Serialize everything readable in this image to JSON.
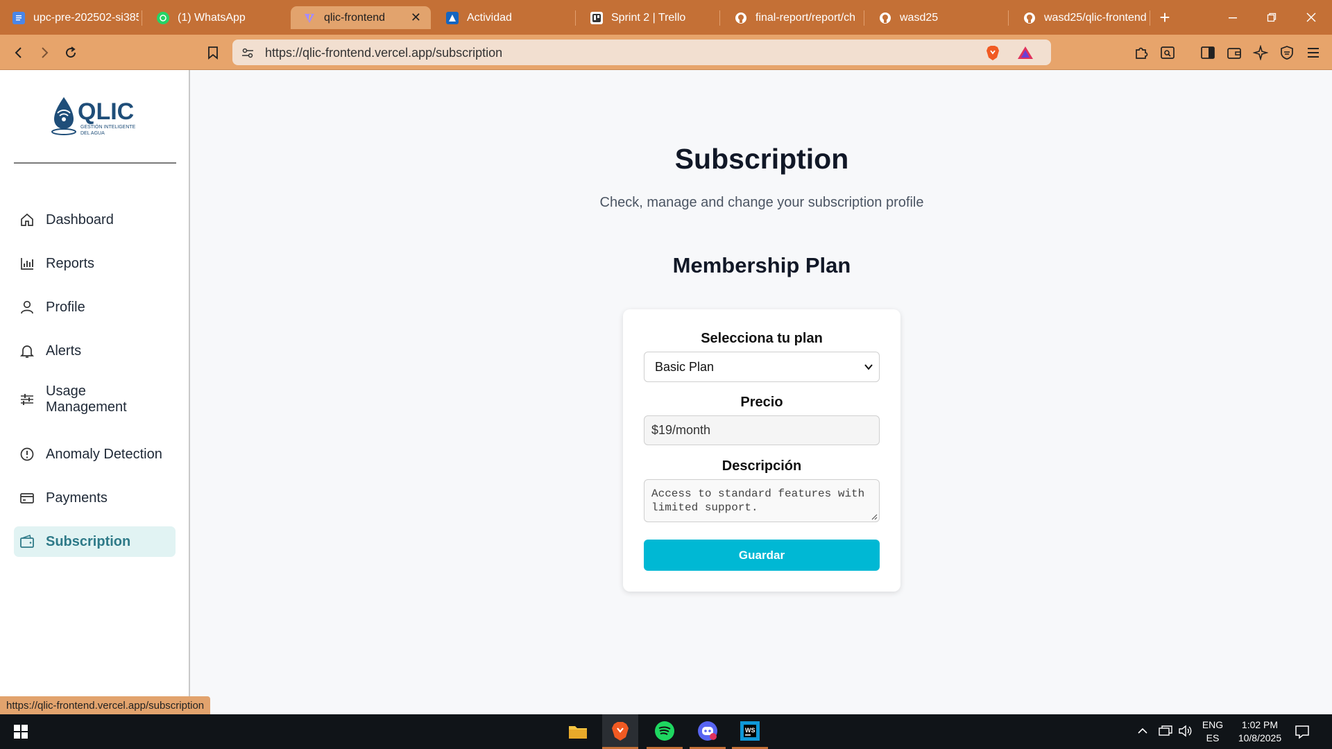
{
  "browser": {
    "tabs": [
      {
        "title": "upc-pre-202502-si385",
        "icon": "docs-icon"
      },
      {
        "title": "(1) WhatsApp",
        "icon": "whatsapp-icon"
      },
      {
        "title": "qlic-frontend",
        "icon": "vite-icon"
      },
      {
        "title": "Actividad",
        "icon": "atlassian-icon"
      },
      {
        "title": "Sprint 2 | Trello",
        "icon": "trello-icon"
      },
      {
        "title": "final-report/report/ch",
        "icon": "github-icon"
      },
      {
        "title": "wasd25",
        "icon": "github-icon"
      },
      {
        "title": "wasd25/qlic-frontend",
        "icon": "github-icon"
      }
    ],
    "active_tab": 2,
    "new_tab_label": "+",
    "url": "https://qlic-frontend.vercel.app/subscription",
    "status_url": "https://qlic-frontend.vercel.app/subscription"
  },
  "sidebar": {
    "logo": {
      "name": "QLIC",
      "tagline_1": "GESTIÓN INTELIGENTE",
      "tagline_2": "DEL AGUA"
    },
    "items": [
      {
        "label": "Dashboard",
        "icon": "home-icon"
      },
      {
        "label": "Reports",
        "icon": "bar-chart-icon"
      },
      {
        "label": "Profile",
        "icon": "user-icon"
      },
      {
        "label": "Alerts",
        "icon": "bell-icon"
      },
      {
        "label": "Usage\nManagement",
        "icon": "sliders-icon"
      },
      {
        "label": "Anomaly Detection",
        "icon": "alert-circle-icon"
      },
      {
        "label": "Payments",
        "icon": "credit-card-icon"
      },
      {
        "label": "Subscription",
        "icon": "wallet-icon",
        "active": true
      }
    ]
  },
  "main": {
    "title": "Subscription",
    "subtitle": "Check, manage and change your subscription profile",
    "section_title": "Membership Plan",
    "form": {
      "plan_label": "Selecciona tu plan",
      "plan_value": "Basic Plan",
      "price_label": "Precio",
      "price_value": "$19/month",
      "description_label": "Descripción",
      "description_value": "Access to standard features with limited support.",
      "save_label": "Guardar"
    }
  },
  "taskbar": {
    "language_top": "ENG",
    "language_bottom": "ES",
    "time": "1:02 PM",
    "date": "10/8/2025"
  },
  "colors": {
    "browser_frame": "#c47036",
    "active_nav_bg": "#e1f3f3",
    "active_nav_text": "#2e7a88",
    "primary_button": "#00b8d4",
    "logo_blue": "#1f4e79"
  }
}
